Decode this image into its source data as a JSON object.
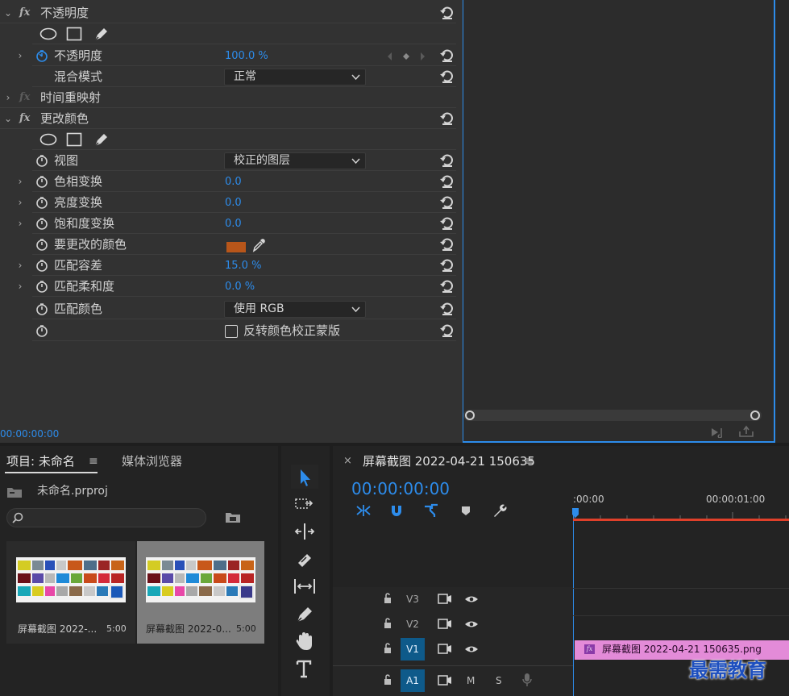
{
  "effects": {
    "opacity_section": {
      "title": "不透明度"
    },
    "opacity": {
      "label": "不透明度",
      "value": "100.0 %"
    },
    "blend_mode": {
      "label": "混合模式",
      "value": "正常"
    },
    "time_remap": {
      "title": "时间重映射"
    },
    "change_color": {
      "title": "更改颜色"
    },
    "view": {
      "label": "视图",
      "value": "校正的图层"
    },
    "hue_transform": {
      "label": "色相变换",
      "value": "0.0"
    },
    "lightness_transform": {
      "label": "亮度变换",
      "value": "0.0"
    },
    "saturation_transform": {
      "label": "饱和度变换",
      "value": "0.0"
    },
    "color_to_change": {
      "label": "要更改的颜色",
      "swatch": "#b8561a"
    },
    "match_tolerance": {
      "label": "匹配容差",
      "value": "15.0 %"
    },
    "match_softness": {
      "label": "匹配柔和度",
      "value": "0.0 %"
    },
    "match_colors": {
      "label": "匹配颜色",
      "value": "使用 RGB"
    },
    "invert_mask": {
      "label": "反转颜色校正蒙版",
      "checked": false
    },
    "timecode": "00:00:00:00"
  },
  "project": {
    "tab_project": "项目: 未命名",
    "tab_media": "媒体浏览器",
    "file_name": "未命名.prproj",
    "search_placeholder": "",
    "items": [
      {
        "name": "屏幕截图 2022-...",
        "duration": "5:00"
      },
      {
        "name": "屏幕截图 2022-0...",
        "duration": "5:00"
      }
    ]
  },
  "timeline": {
    "sequence_name": "屏幕截图 2022-04-21 150635",
    "timecode": "00:00:00:00",
    "ruler_labels": [
      ":00:00",
      "00:00:01:00"
    ],
    "tracks": {
      "v3": "V3",
      "v2": "V2",
      "v1": "V1",
      "a1": "A1",
      "mute": "M",
      "solo": "S"
    },
    "clip_name": "屏幕截图 2022-04-21 150635.png"
  },
  "watermark": "最需教育",
  "colors": {
    "accent": "#2d8ceb",
    "panel": "#323232",
    "playhead": "#e0402a",
    "clip": "#e38bd8"
  }
}
